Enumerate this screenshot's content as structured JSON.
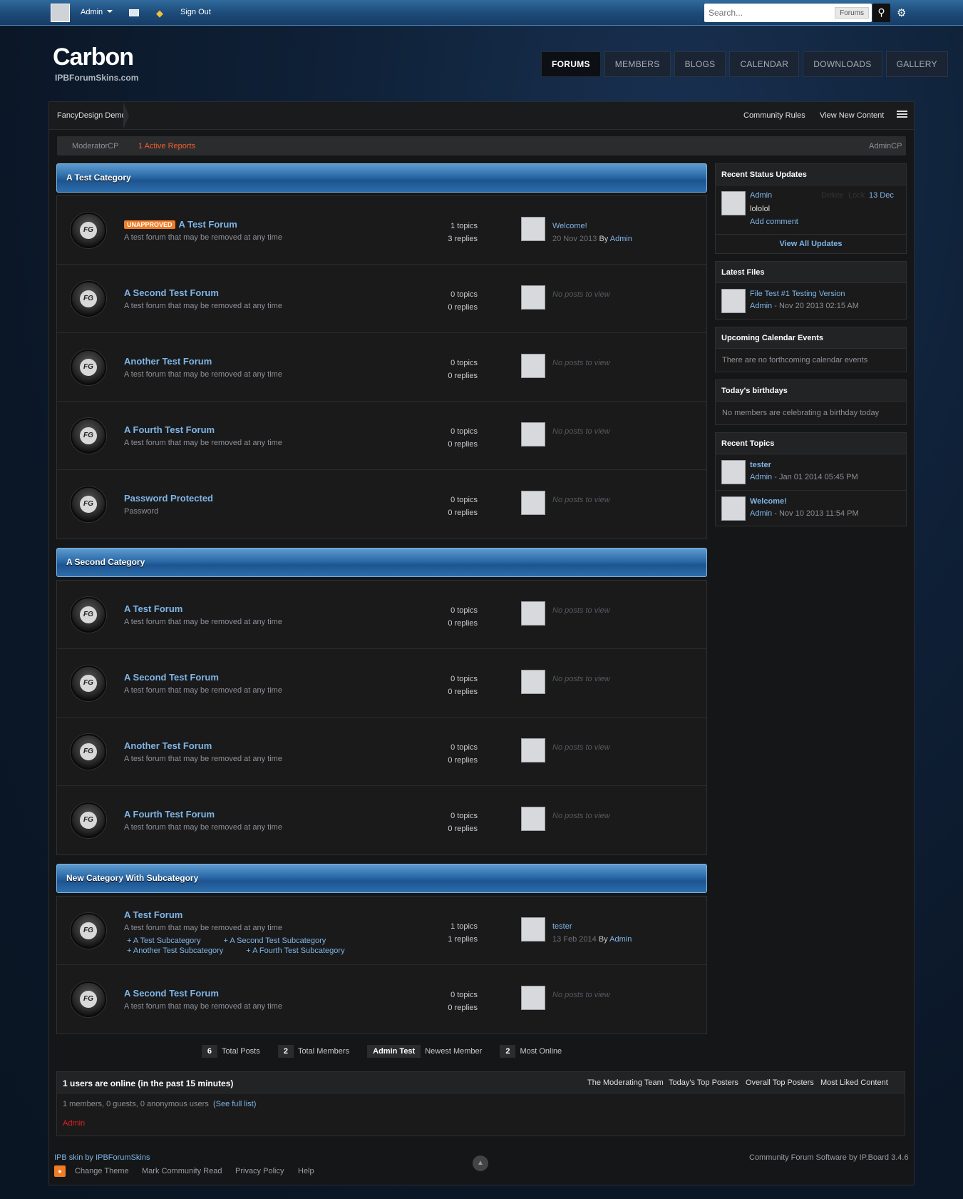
{
  "topbar": {
    "user": "Admin",
    "signout": "Sign Out",
    "search_placeholder": "Search...",
    "search_scope": "Forums"
  },
  "brand": {
    "name": "Carbon",
    "sub": "IPBForumSkins.com"
  },
  "nav": [
    "FORUMS",
    "MEMBERS",
    "BLOGS",
    "CALENDAR",
    "DOWNLOADS",
    "GALLERY"
  ],
  "breadcrumb": "FancyDesign Demo",
  "crumb_links": [
    "Community Rules",
    "View New Content"
  ],
  "modbar": {
    "mod": "ModeratorCP",
    "reports": "1 Active Reports",
    "admin": "AdminCP"
  },
  "categories": [
    {
      "title": "A Test Category",
      "forums": [
        {
          "badge": "UNAPPROVED",
          "title": "A Test Forum",
          "desc": "A test forum that may be removed at any time",
          "topics": "1 topics",
          "replies": "3 replies",
          "last_title": "Welcome!",
          "last_date": "20 Nov 2013",
          "last_by": "By",
          "last_user": "Admin"
        },
        {
          "title": "A Second Test Forum",
          "desc": "A test forum that may be removed at any time",
          "topics": "0 topics",
          "replies": "0 replies",
          "noposts": "No posts to view"
        },
        {
          "title": "Another Test Forum",
          "desc": "A test forum that may be removed at any time",
          "topics": "0 topics",
          "replies": "0 replies",
          "noposts": "No posts to view"
        },
        {
          "title": "A Fourth Test Forum",
          "desc": "A test forum that may be removed at any time",
          "topics": "0 topics",
          "replies": "0 replies",
          "noposts": "No posts to view"
        },
        {
          "title": "Password Protected",
          "desc": "Password",
          "topics": "0 topics",
          "replies": "0 replies",
          "noposts": "No posts to view"
        }
      ]
    },
    {
      "title": "A Second Category",
      "forums": [
        {
          "title": "A Test Forum",
          "desc": "A test forum that may be removed at any time",
          "topics": "0 topics",
          "replies": "0 replies",
          "noposts": "No posts to view"
        },
        {
          "title": "A Second Test Forum",
          "desc": "A test forum that may be removed at any time",
          "topics": "0 topics",
          "replies": "0 replies",
          "noposts": "No posts to view"
        },
        {
          "title": "Another Test Forum",
          "desc": "A test forum that may be removed at any time",
          "topics": "0 topics",
          "replies": "0 replies",
          "noposts": "No posts to view"
        },
        {
          "title": "A Fourth Test Forum",
          "desc": "A test forum that may be removed at any time",
          "topics": "0 topics",
          "replies": "0 replies",
          "noposts": "No posts to view"
        }
      ]
    },
    {
      "title": "New Category With Subcategory",
      "forums": [
        {
          "title": "A Test Forum",
          "desc": "A test forum that may be removed at any time",
          "topics": "1 topics",
          "replies": "1 replies",
          "last_title": "tester",
          "last_date": "13 Feb 2014",
          "last_by": "By",
          "last_user": "Admin",
          "subs": [
            "A Test Subcategory",
            "A Second Test Subcategory",
            "Another Test Subcategory",
            "A Fourth Test Subcategory"
          ]
        },
        {
          "title": "A Second Test Forum",
          "desc": "A test forum that may be removed at any time",
          "topics": "0 topics",
          "replies": "0 replies",
          "noposts": "No posts to view"
        }
      ]
    }
  ],
  "board_stats": [
    {
      "value": "6",
      "label": "Total Posts"
    },
    {
      "value": "2",
      "label": "Total Members"
    },
    {
      "value": "Admin Test",
      "label": "Newest Member"
    },
    {
      "value": "2",
      "label": "Most Online"
    }
  ],
  "sidebar": {
    "status": {
      "title": "Recent Status Updates",
      "user": "Admin",
      "delete": "Delete",
      "lock": "Lock",
      "date": "13 Dec",
      "text": "lololol",
      "comment": "Add comment",
      "view_all": "View All Updates"
    },
    "files": {
      "title": "Latest Files",
      "file": "File Test #1 Testing Version",
      "user": "Admin",
      "date": "- Nov 20 2013 02:15 AM"
    },
    "calendar": {
      "title": "Upcoming Calendar Events",
      "text": "There are no forthcoming calendar events"
    },
    "birthdays": {
      "title": "Today's birthdays",
      "text": "No members are celebrating a birthday today"
    },
    "topics": {
      "title": "Recent Topics",
      "items": [
        {
          "title": "tester",
          "user": "Admin",
          "date": "- Jan 01 2014 05:45 PM"
        },
        {
          "title": "Welcome!",
          "user": "Admin",
          "date": "- Nov 10 2013 11:54 PM"
        }
      ]
    }
  },
  "online": {
    "title": "1 users are online (in the past 15 minutes)",
    "links": [
      "The Moderating Team",
      "Today's Top Posters",
      "Overall Top Posters",
      "Most Liked Content"
    ],
    "counts": "1 members, 0 guests, 0 anonymous users",
    "full_list": "(See full list)",
    "user": "Admin"
  },
  "footer": {
    "skin": "IPB skin by IPBForumSkins",
    "powered": "Community Forum Software by IP.Board 3.4.6",
    "links": [
      "Change Theme",
      "Mark Community Read",
      "Privacy Policy",
      "Help"
    ]
  },
  "colors": {
    "accent": "#7fb5e6",
    "badge": "#f07c26",
    "reports": "#f0602a",
    "admin": "#e02020"
  }
}
